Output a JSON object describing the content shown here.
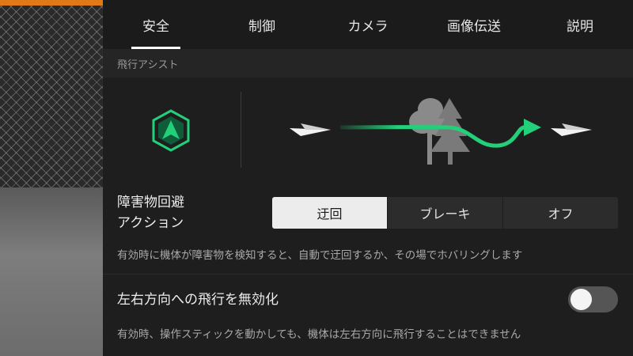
{
  "tabs": [
    {
      "label": "安全",
      "active": true
    },
    {
      "label": "制御",
      "active": false
    },
    {
      "label": "カメラ",
      "active": false
    },
    {
      "label": "画像伝送",
      "active": false
    },
    {
      "label": "説明",
      "active": false
    }
  ],
  "section": {
    "title": "飛行アシスト"
  },
  "obstacle": {
    "label_line1": "障害物回避",
    "label_line2": "アクション",
    "options": [
      "迂回",
      "ブレーキ",
      "オフ"
    ],
    "selected": "迂回",
    "description": "有効時に機体が障害物を検知すると、自動で迂回するか、その場でホバリングします"
  },
  "lateral": {
    "label": "左右方向への飛行を無効化",
    "enabled": false,
    "description": "有効時、操作スティックを動かしても、機体は左右方向に飛行することはできません"
  },
  "colors": {
    "accent_green": "#22d07a",
    "toggle_off": "#555555"
  },
  "icons": {
    "assist": "hexagon-arrow-icon",
    "plane": "paper-plane-icon",
    "trees": "trees-icon"
  }
}
